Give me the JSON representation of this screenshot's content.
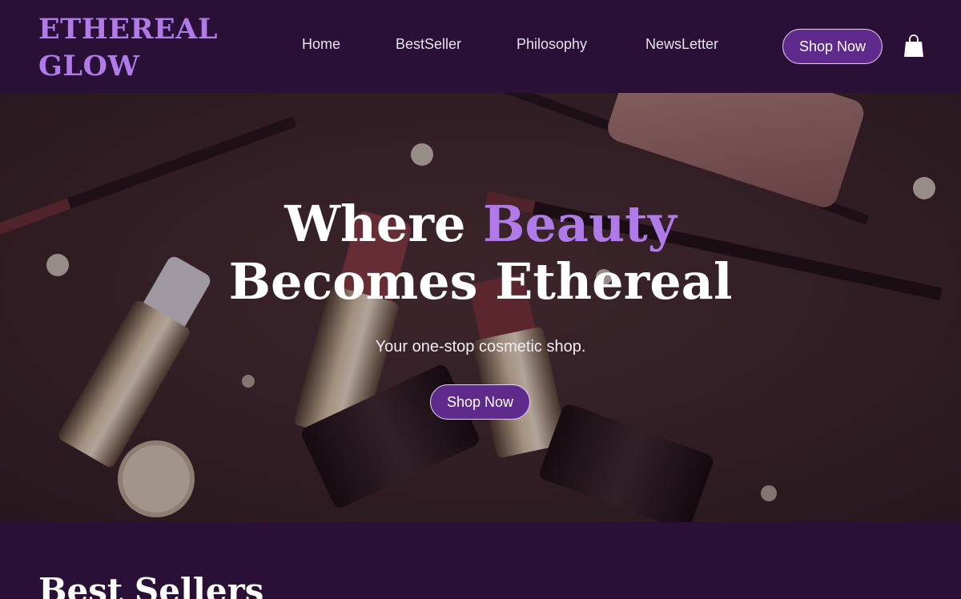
{
  "brand": {
    "line1": "ETHEREAL",
    "line2": "GLOW",
    "color": "#b07ae8"
  },
  "nav": {
    "home": "Home",
    "bestseller": "BestSeller",
    "philosophy": "Philosophy",
    "newsletter": "NewsLetter"
  },
  "header": {
    "cta_label": "Shop Now",
    "cart_icon": "shopping-bag-icon"
  },
  "hero": {
    "title_part1": "Where ",
    "title_accent": "Beauty",
    "title_line2": "Becomes Ethereal",
    "subtitle": "Your one-stop cosmetic shop.",
    "cta_label": "Shop Now"
  },
  "best_sellers": {
    "title": "Best Sellers"
  },
  "colors": {
    "background": "#2a1036",
    "accent": "#b07ae8",
    "button": "#5e2a8c"
  }
}
